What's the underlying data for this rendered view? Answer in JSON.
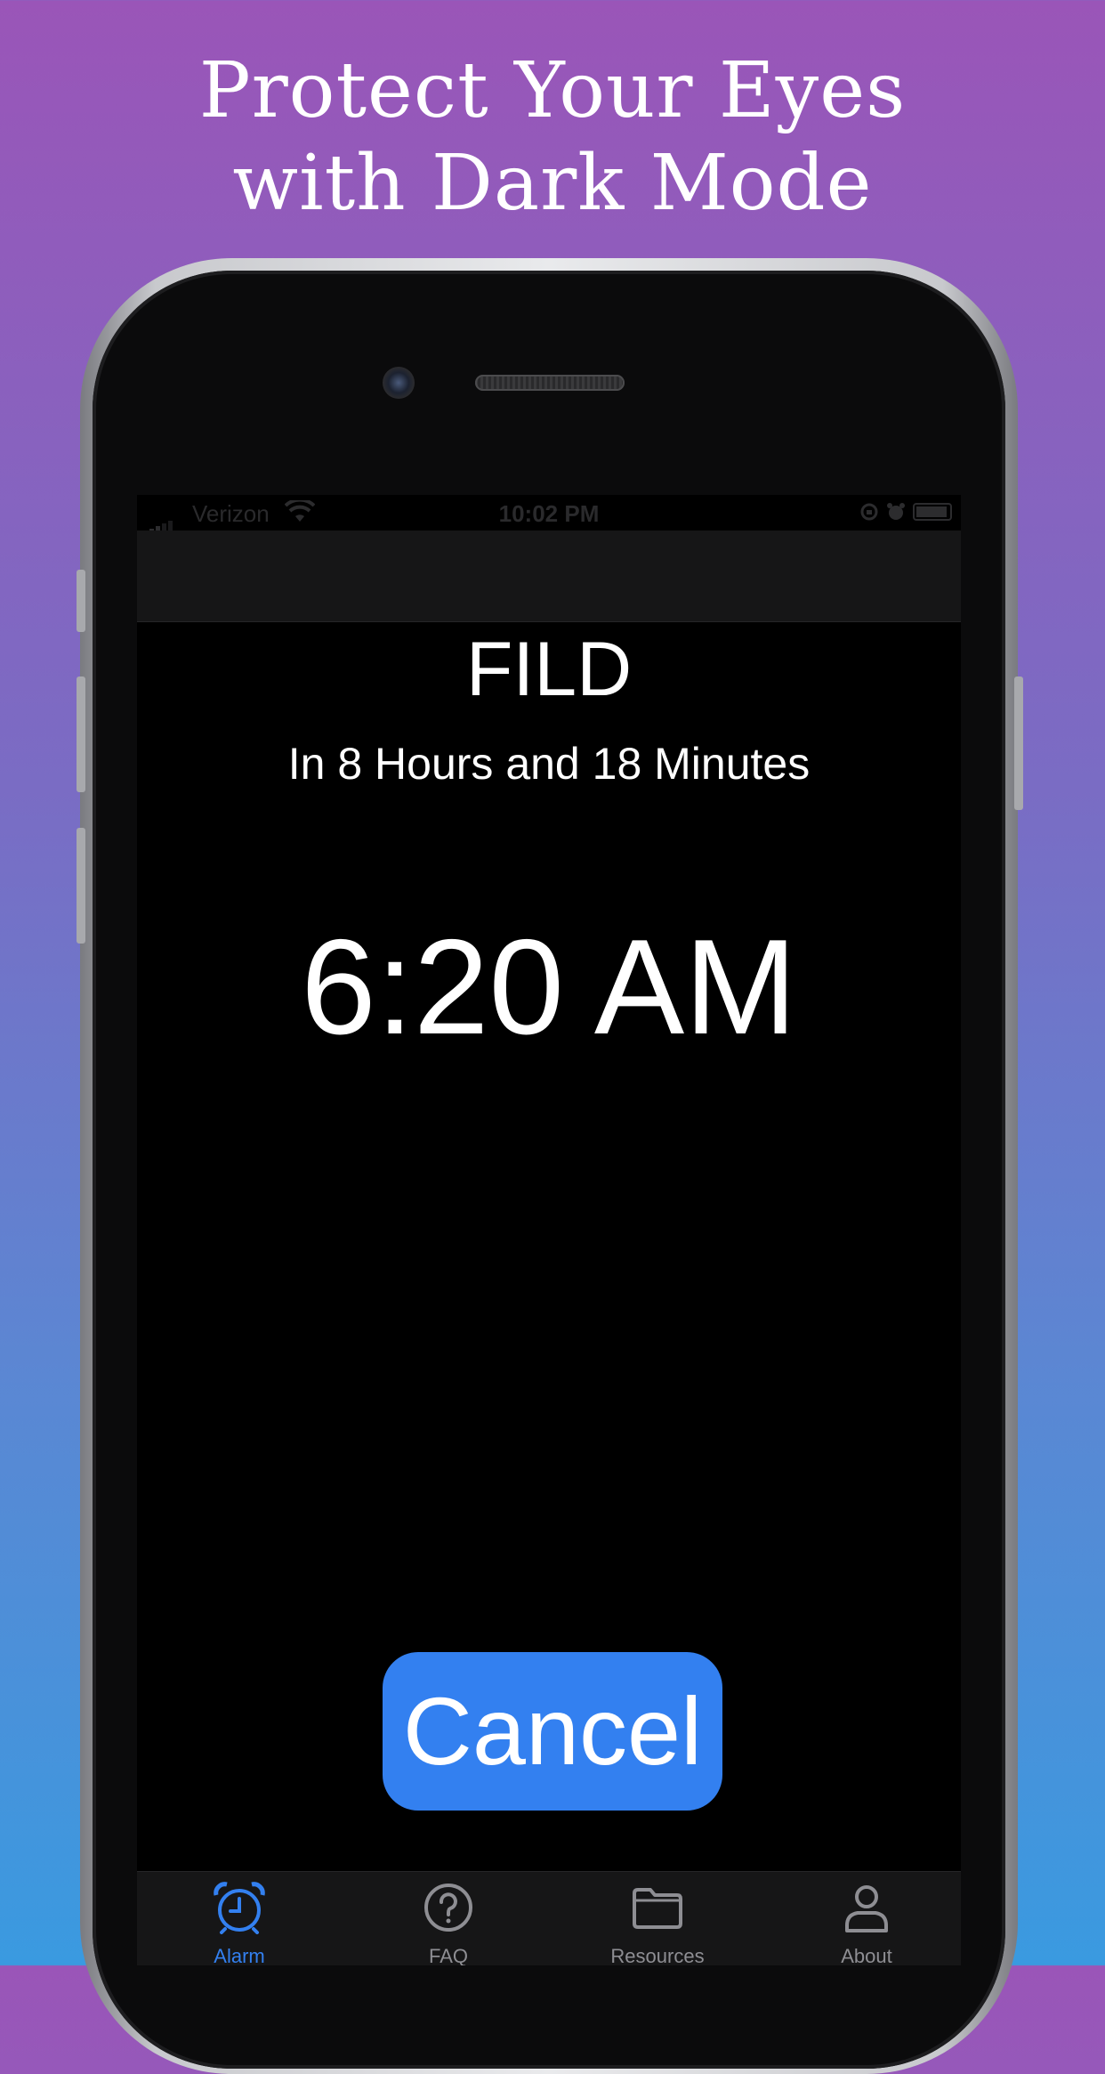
{
  "headline": {
    "line1": "Protect Your Eyes",
    "line2": "with Dark Mode"
  },
  "status_bar": {
    "carrier": "Verizon",
    "time": "10:02 PM"
  },
  "alarm": {
    "name": "FILD",
    "countdown": "In 8 Hours and 18 Minutes",
    "time": "6:20 AM",
    "cancel_label": "Cancel"
  },
  "tabs": [
    {
      "label": "Alarm",
      "icon": "alarm-clock-icon",
      "active": true
    },
    {
      "label": "FAQ",
      "icon": "question-circle-icon",
      "active": false
    },
    {
      "label": "Resources",
      "icon": "folder-icon",
      "active": false
    },
    {
      "label": "About",
      "icon": "person-icon",
      "active": false
    }
  ],
  "colors": {
    "accent": "#3380f0",
    "inactive_tab": "#8e8e93",
    "screen_bg": "#000000"
  }
}
